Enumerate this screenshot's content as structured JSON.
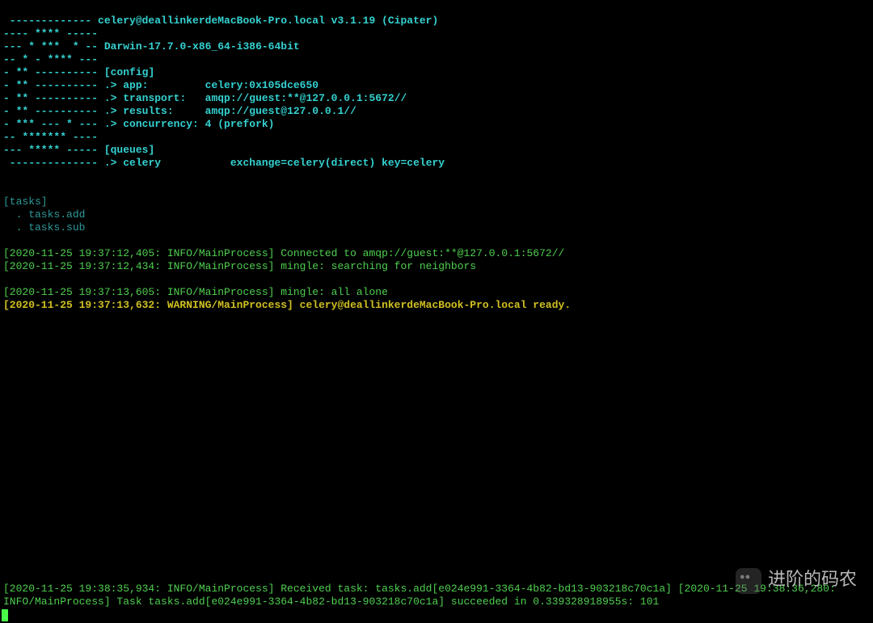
{
  "banner": {
    "l1": " -------------",
    "l1b": " celery@deallinkerdeMacBook-Pro.local v3.1.19 (Cipater)",
    "l2": "---- **** -----",
    "l3": "--- * ***  * --",
    "l3b": " Darwin-17.7.0-x86_64-i386-64bit",
    "l4": "-- * - **** ---",
    "l5": "- ** ----------",
    "l5b": " [config]",
    "l6": "- ** ----------",
    "l6b": " .> app:         celery:0x105dce650",
    "l7": "- ** ----------",
    "l7b": " .> transport:   amqp://guest:**@127.0.0.1:5672//",
    "l8": "- ** ----------",
    "l8b": " .> results:     amqp://guest@127.0.0.1//",
    "l9": "- *** --- * ---",
    "l9b": " .> concurrency: 4 (prefork)",
    "l10": "-- ******* ----",
    "l11": "--- ***** -----",
    "l11b": " [queues]",
    "l12": " --------------",
    "l12b": " .> celery           exchange=celery(direct) key=celery"
  },
  "tasks": {
    "header": "[tasks]",
    "t1": "  . tasks.add",
    "t2": "  . tasks.sub"
  },
  "logs": {
    "log1": "[2020-11-25 19:37:12,405: INFO/MainProcess] Connected to amqp://guest:**@127.0.0.1:5672//",
    "log2": "[2020-11-25 19:37:12,434: INFO/MainProcess] mingle: searching for neighbors",
    "log3": "[2020-11-25 19:37:13,605: INFO/MainProcess] mingle: all alone",
    "log4": "[2020-11-25 19:37:13,632: WARNING/MainProcess] celery@deallinkerdeMacBook-Pro.local ready.",
    "log5": "[2020-11-25 19:38:35,934: INFO/MainProcess] Received task: tasks.add[e024e991-3364-4b82-bd13-903218c70c1a]",
    "log6": "[2020-11-25 19:38:36,280: INFO/MainProcess] Task tasks.add[e024e991-3364-4b82-bd13-903218c70c1a] succeeded in 0.339328918955s: 101"
  },
  "watermark": "进阶的码农"
}
